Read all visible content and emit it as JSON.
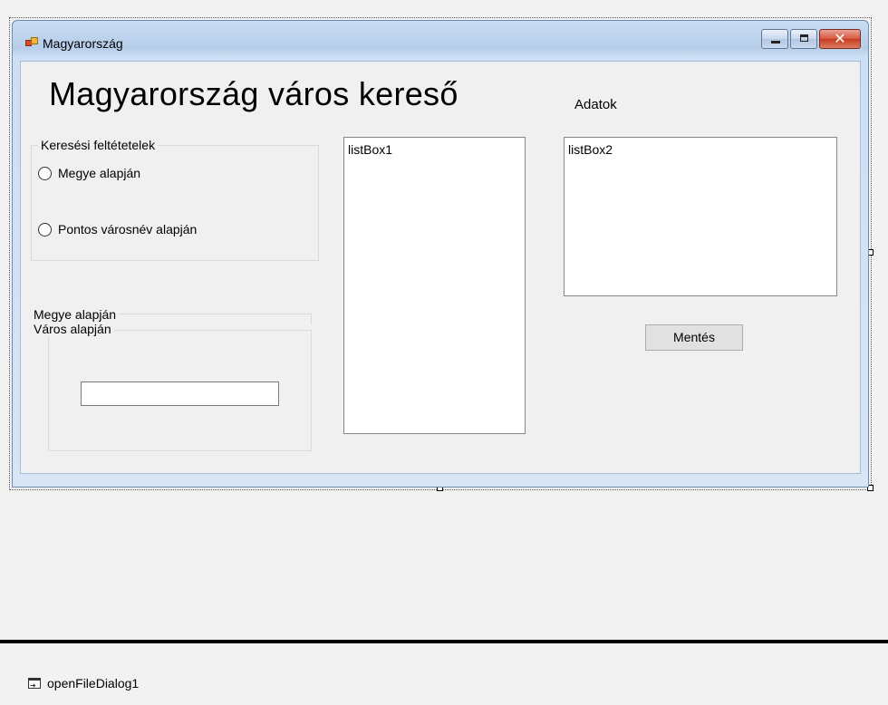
{
  "window": {
    "title": "Magyarország",
    "icon": "windows-form-icon",
    "caption_buttons": [
      "minimize-icon",
      "maximize-icon",
      "close-icon"
    ]
  },
  "form": {
    "heading": "Magyarország város kereső",
    "adatok_label": "Adatok",
    "search_group": {
      "legend": "Keresési feltétetelek",
      "options": [
        "Megye alapján",
        "Pontos városnév alapján"
      ]
    },
    "megye_group": {
      "legend": "Megye alapján"
    },
    "varos_group": {
      "legend": "Város alapján",
      "textbox_value": ""
    },
    "listbox1": {
      "name": "listBox1"
    },
    "listbox2": {
      "name": "listBox2"
    },
    "save_button": "Mentés"
  },
  "component_tray": {
    "items": [
      {
        "name": "openFileDialog1",
        "icon": "open-file-dialog-icon"
      }
    ]
  }
}
